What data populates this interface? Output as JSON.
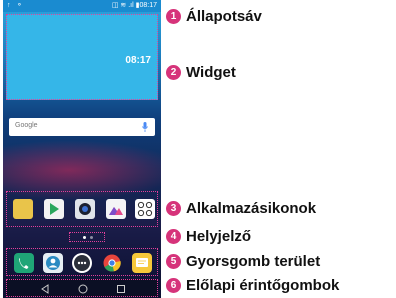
{
  "status_bar": {
    "left_icons": "↑ ⚬",
    "right_text": "◫ ≋ .ıl ▮08:17"
  },
  "widget": {
    "time": "08:17"
  },
  "search": {
    "logo_text": "Google"
  },
  "callouts": [
    {
      "number": "1",
      "label": "Állapotsáv"
    },
    {
      "number": "2",
      "label": "Widget"
    },
    {
      "number": "3",
      "label": "Alkalmazásikonok"
    },
    {
      "number": "4",
      "label": "Helyjelző"
    },
    {
      "number": "5",
      "label": "Gyorsgomb terület"
    },
    {
      "number": "6",
      "label": "Előlapi érintőgombok"
    }
  ],
  "colors": {
    "badge": "#d6337a",
    "highlight_border": "#e2409a",
    "status_bar": "#1a8bd0"
  }
}
